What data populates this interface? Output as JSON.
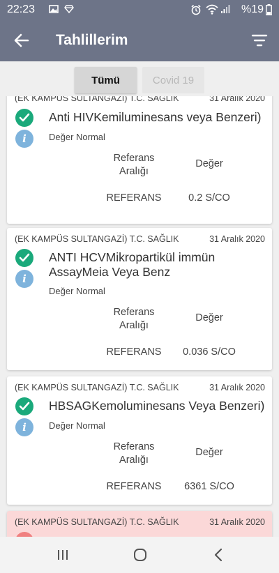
{
  "status_bar": {
    "time": "22:23",
    "battery": "%19",
    "icons": [
      "image-icon",
      "diamond-icon",
      "alarm-icon",
      "wifi-icon",
      "signal-icon",
      "battery-icon"
    ]
  },
  "app_bar": {
    "title": "Tahlillerim",
    "icons": [
      "back-arrow-icon",
      "filter-icon"
    ]
  },
  "tabs": [
    {
      "label": "Tümü",
      "active": true
    },
    {
      "label": "Covid 19",
      "active": false
    }
  ],
  "colors": {
    "header": "#6d7488",
    "check": "#1aa97b",
    "info": "#7eb3dc",
    "alert_card": "#fbd8d8"
  },
  "cards": [
    {
      "hospital": "(EK KAMPÜS SULTANGAZİ) T.C. SAĞLIK",
      "date": "31 Aralık 2020",
      "test": "Anti HIVKemiluminesans veya Benzeri)",
      "status": "Değer Normal",
      "ref_header": "Referans Aralığı",
      "val_header": "Değer",
      "ref_value": "REFERANS",
      "value": "0.2 S/CO"
    },
    {
      "hospital": "(EK KAMPÜS SULTANGAZİ) T.C. SAĞLIK",
      "date": "31 Aralık 2020",
      "test": "ANTI HCVMikropartikül immün AssayMeia Veya Benz",
      "status": "Değer Normal",
      "ref_header": "Referans Aralığı",
      "val_header": "Değer",
      "ref_value": "REFERANS",
      "value": "0.036 S/CO"
    },
    {
      "hospital": "(EK KAMPÜS SULTANGAZİ) T.C. SAĞLIK",
      "date": "31 Aralık 2020",
      "test": "HBSAGKemoluminesans Veya Benzeri)",
      "status": "Değer Normal",
      "ref_header": "Referans Aralığı",
      "val_header": "Değer",
      "ref_value": "REFERANS",
      "value": "6361 S/CO"
    },
    {
      "hospital": "(EK KAMPÜS SULTANGAZİ) T.C. SAĞLIK",
      "date": "31 Aralık 2020"
    }
  ],
  "nav_bar": {
    "icons": [
      "recents-icon",
      "home-icon",
      "back-nav-icon"
    ]
  }
}
